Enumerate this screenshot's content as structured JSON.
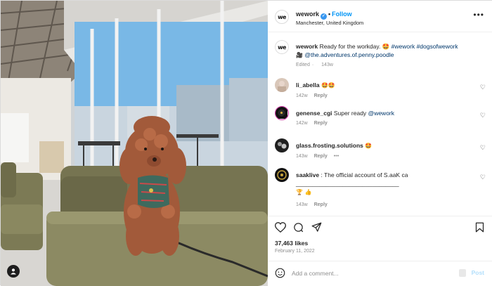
{
  "post": {
    "username": "wework",
    "verified": true,
    "follow_label": "Follow",
    "location": "Manchester, United Kingdom",
    "more_icon": "more-dots-icon"
  },
  "caption": {
    "username": "wework",
    "text": "Ready for the workday. 🤩",
    "hashtag_1": "#wework",
    "hashtag_2": "#dogsofwework",
    "camera_emoji": "🎥",
    "credit": "@the.adventures.of.penny.poodle",
    "edited": "Edited",
    "age": "143w"
  },
  "comments": [
    {
      "user": "li_abella",
      "text": "🤩🤩",
      "age": "142w",
      "reply": "Reply"
    },
    {
      "user": "genense_cgi",
      "text": "Super ready",
      "mention": "@wework",
      "age": "142w",
      "reply": "Reply"
    },
    {
      "user": "glass.frosting.solutions",
      "text": "🤩",
      "age": "143w",
      "reply": "Reply",
      "more": "•••"
    },
    {
      "user": "saaklive",
      "text": ": The official account of S.aaK",
      "text_tail": "ca _______________________________",
      "emojis": "🏆 👍",
      "age": "143w",
      "reply": "Reply"
    }
  ],
  "stats": {
    "likes": "37,463 likes",
    "date": "February 11, 2022"
  },
  "comment_box": {
    "placeholder": "Add a comment...",
    "post_label": "Post"
  },
  "logo_text": "we",
  "colors": {
    "accent": "#0095f6",
    "verified": "#3897f0",
    "muted": "#8e8e8e",
    "post_disabled": "#b2dffc"
  }
}
